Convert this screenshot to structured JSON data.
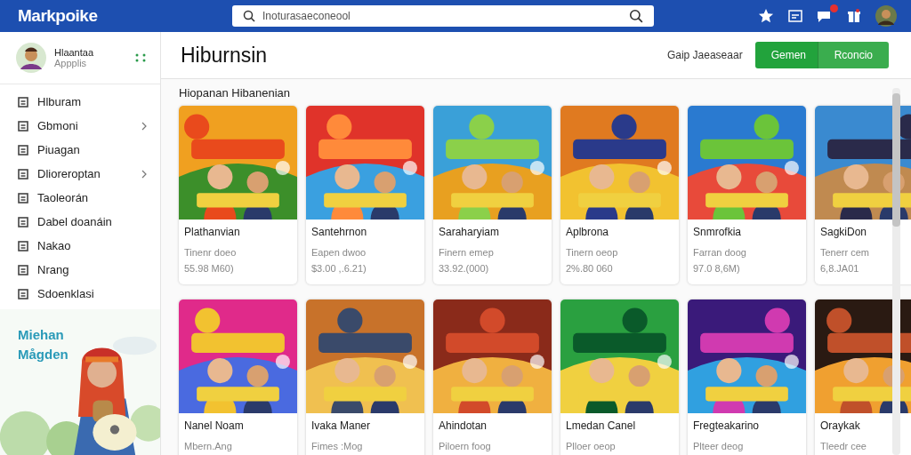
{
  "header": {
    "logo": "Markpoike",
    "search": {
      "placeholder": "Inoturasaeconeool"
    },
    "notification": true
  },
  "profile": {
    "name": "Hlaantaa",
    "subtitle": "Appplis"
  },
  "sidebar": {
    "items": [
      {
        "label": "Hlburam",
        "expandable": false
      },
      {
        "label": "Gbmoni",
        "expandable": true
      },
      {
        "label": "Piuagan",
        "expandable": false
      },
      {
        "label": "Dlioreroptan",
        "expandable": true
      },
      {
        "label": "Taoleorán",
        "expandable": false
      },
      {
        "label": "Dabel doanáin",
        "expandable": false
      },
      {
        "label": "Nakao",
        "expandable": false
      },
      {
        "label": "Nrang",
        "expandable": false
      },
      {
        "label": "Sdoenklasi",
        "expandable": false
      }
    ],
    "promo": {
      "title": "Miehan Mågden"
    }
  },
  "page": {
    "title": "Hiburnsin",
    "filter": "Gaip Jaeaseaar",
    "buttons": [
      {
        "label": "Gemen",
        "selected": true
      },
      {
        "label": "Rconcio",
        "selected": false
      }
    ]
  },
  "section": {
    "title": "Hiopanan Hibanenian",
    "cards": [
      {
        "name": "Plathanvian",
        "line1": "Tinenr doeo",
        "line2": "55.98 M60)"
      },
      {
        "name": "Santehrnon",
        "line1": "Eapen dwoo",
        "line2": "$3.00 ,.6.21)"
      },
      {
        "name": "Saraharyiam",
        "line1": "Finern emep",
        "line2": "33.92.(000)"
      },
      {
        "name": "Aplbrona",
        "line1": "Tinern oeop",
        "line2": "2%.80 060"
      },
      {
        "name": "Snmrofkia",
        "line1": "Farran doog",
        "line2": "97.0 8,6M)"
      },
      {
        "name": "SagkiDon",
        "line1": "Tenerr cem",
        "line2": "6,8.JA01"
      },
      {
        "name": "Nanel Noam",
        "line1": "Mbern.Ang"
      },
      {
        "name": "Ivaka Maner",
        "line1": "Fimes :Mog"
      },
      {
        "name": "Ahindotan",
        "line1": "Piloern foog"
      },
      {
        "name": "Lmedan Canel",
        "line1": "Plloer oeop"
      },
      {
        "name": "Fregteakarino",
        "line1": "Plteer deog"
      },
      {
        "name": "Oraykak",
        "line1": "Tleedr cee"
      }
    ]
  }
}
